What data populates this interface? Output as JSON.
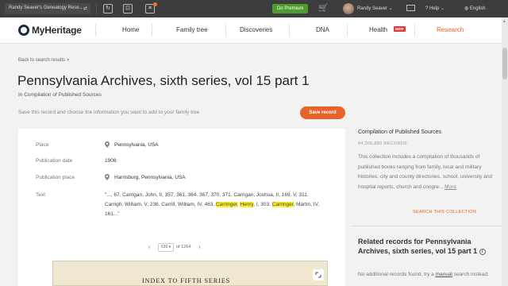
{
  "topbar": {
    "site_name": "Randy Seaver's Genealogy Rese...",
    "premium_label": "Go Premium",
    "user_name": "Randy Seaver",
    "help_label": "Help",
    "language_label": "English"
  },
  "nav": {
    "brand": "MyHeritage",
    "items": [
      "Home",
      "Family tree",
      "Discoveries",
      "DNA",
      "Health",
      "Research"
    ],
    "health_badge": "NEW"
  },
  "page": {
    "back_link": "Back to search results >",
    "title": "Pennsylvania Archives, sixth series, vol 15 part 1",
    "collection_line": "In Compilation of Published Sources",
    "save_hint": "Save this record and choose the information you want to add to your family tree",
    "save_button": "Save record"
  },
  "record": {
    "place_label": "Place",
    "place_value": "Pennsylvania, USA",
    "pub_date_label": "Publication date",
    "pub_date_value": "1906",
    "pub_place_label": "Publication place",
    "pub_place_value": "Harrisburg, Pennsylvania, USA",
    "text_label": "Text",
    "text_part1": "\"..., 67. Carrigan, John, II, 357, 361, 364. 367, 370, 371. Carrigan, Joshua, II, 169. V, 311. Carrigh, William, V, 238. Carrill, William, IV, 463.",
    "text_hl1": "Carringer",
    "text_part2": ",",
    "text_hl2": "Henry",
    "text_part3": ", I, 303.",
    "text_hl3": "Carringer",
    "text_part4": ", Martin, IV, 161...\"",
    "page_current": "639",
    "page_total": "of 1264",
    "doc_header": "INDEX TO FIFTH SERIES"
  },
  "sidebar": {
    "collection_name": "Compilation of Published Sources",
    "record_count": "84,206,880 RECORDS",
    "description": "This collection includes a compilation of thousands of published books ranging from family, local and military histories, city and county directories, school, university and hospital reports, church and congre...",
    "more_link": "More",
    "search_link": "SEARCH THIS COLLECTION",
    "related_title": "Related records for Pennsylvania Archives, sixth series, vol 15 part 1",
    "related_none": "No additional records found, try a",
    "manual_link": "manual",
    "related_tail": "search instead."
  },
  "colors": {
    "accent_orange": "#e8632a",
    "premium_green": "#4e9b2f",
    "highlight_yellow": "#ffee2a",
    "topbar_dark": "#3d3d3d"
  },
  "icons": [
    "user-switch-icon",
    "recent-icon",
    "family-icon",
    "puzzle-icon",
    "cart-icon",
    "mail-icon",
    "help-icon",
    "globe-icon",
    "location-pin-icon",
    "info-icon",
    "expand-icon"
  ]
}
